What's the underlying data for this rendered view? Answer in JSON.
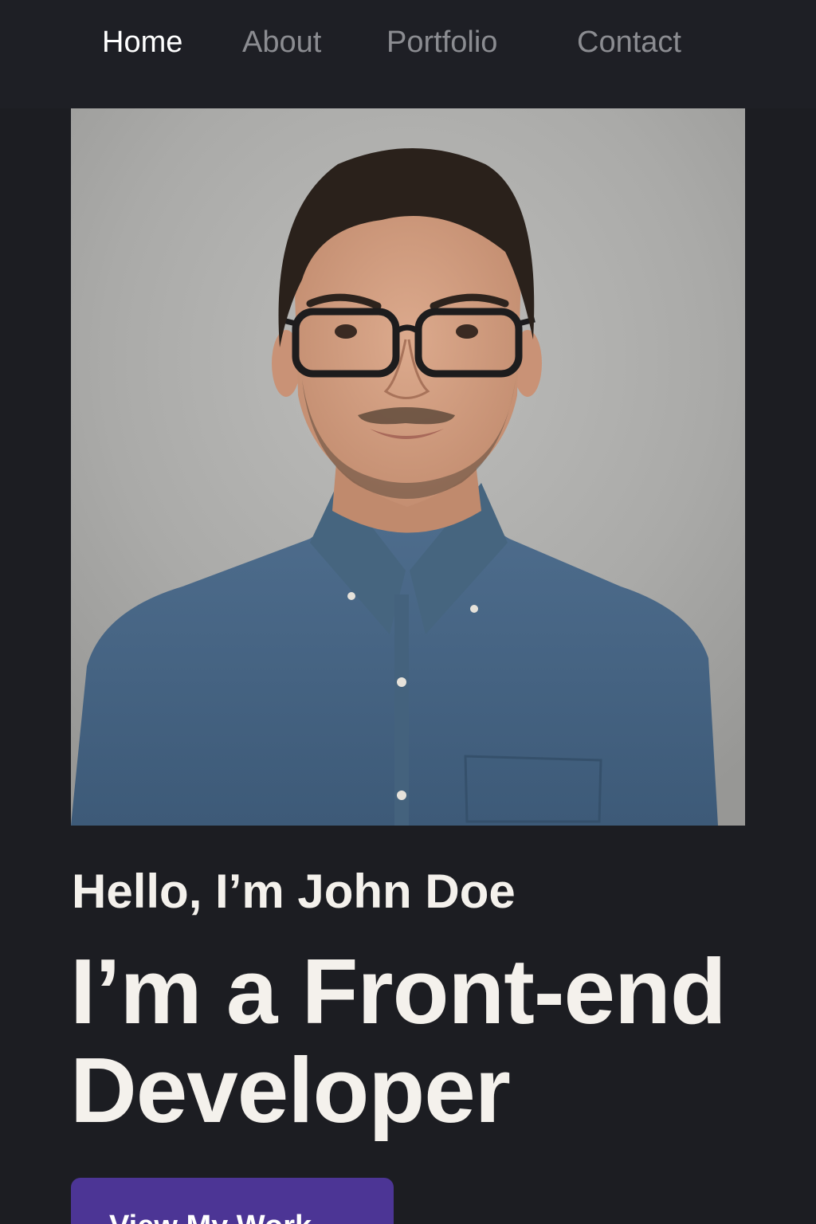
{
  "nav": {
    "items": [
      {
        "label": "Home",
        "active": true
      },
      {
        "label": "About",
        "active": false
      },
      {
        "label": "Portfolio",
        "active": false
      },
      {
        "label": "Contact",
        "active": false
      }
    ]
  },
  "hero": {
    "portrait_icon": "profile-photo",
    "greeting": "Hello, I’m John Doe",
    "headline_line1": "I’m a Front-end",
    "headline_line2": "Developer",
    "cta_label": "View My Work"
  },
  "colors": {
    "background": "#1c1d22",
    "nav_background": "#1e1f25",
    "nav_active": "#ffffff",
    "nav_inactive": "#8b8c91",
    "text": "#f4f1ec",
    "accent": "#4c3595"
  }
}
